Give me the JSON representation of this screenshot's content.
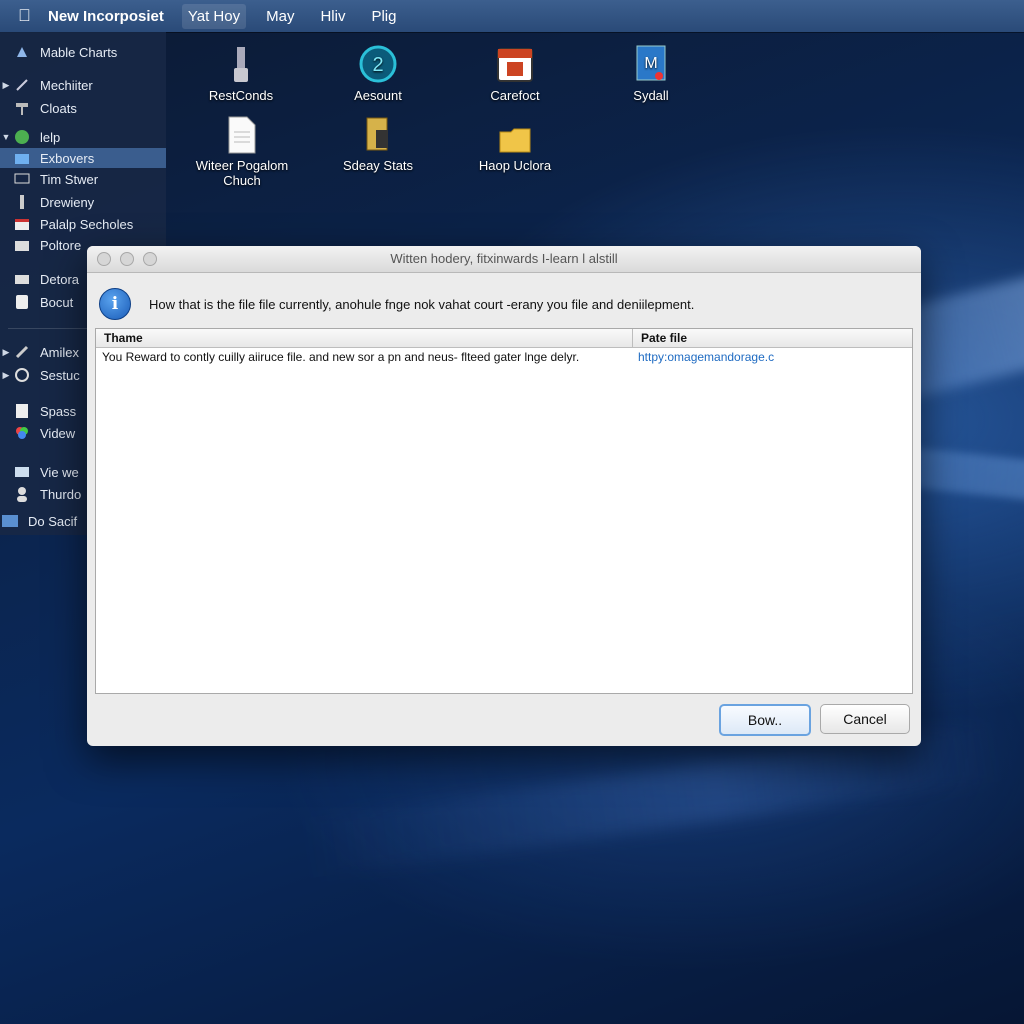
{
  "menubar": {
    "app_name": "New Incorposiet",
    "menus": [
      "Yat Hoy",
      "May",
      "Hliv",
      "Plig"
    ]
  },
  "sidebar": {
    "items": [
      {
        "label": "Mable Charts"
      },
      {
        "label": "Mechiiter"
      },
      {
        "label": "Cloats"
      },
      {
        "label": "lelp"
      },
      {
        "label": "Exbovers"
      },
      {
        "label": "Tim Stwer"
      },
      {
        "label": "Drewieny"
      },
      {
        "label": "Palalp Secholes"
      },
      {
        "label": "Poltore"
      },
      {
        "label": "Detora"
      },
      {
        "label": "Bocut"
      },
      {
        "label": "Amilex"
      },
      {
        "label": "Sestuc"
      },
      {
        "label": "Spass"
      },
      {
        "label": "Videw"
      },
      {
        "label": "Vie we"
      },
      {
        "label": "Thurdo"
      },
      {
        "label": "Do Sacif"
      }
    ]
  },
  "desktop": {
    "icons": [
      {
        "label": "RestConds"
      },
      {
        "label": "Aesount"
      },
      {
        "label": "Carefoct"
      },
      {
        "label": "Sydall"
      },
      {
        "label": "Witeer Pogalom Chuch"
      },
      {
        "label": "Sdeay Stats"
      },
      {
        "label": "Haop Uclora"
      }
    ]
  },
  "dialog": {
    "title": "Witten hodery, fitxinwards  I-learn l alstill",
    "message": "How that is the file file currently, anohule fnge nok vahat court -erany you file and deniilepment.",
    "table": {
      "headers": [
        "Thame",
        "Pate file"
      ],
      "rows": [
        [
          "You Reward to contly cuilly aiiruce file. and new sor a pn and neus- flteed gater lnge delyr.",
          "httpy:omagemandorage.c"
        ]
      ]
    },
    "buttons": {
      "primary": "Bow..",
      "cancel": "Cancel"
    }
  }
}
